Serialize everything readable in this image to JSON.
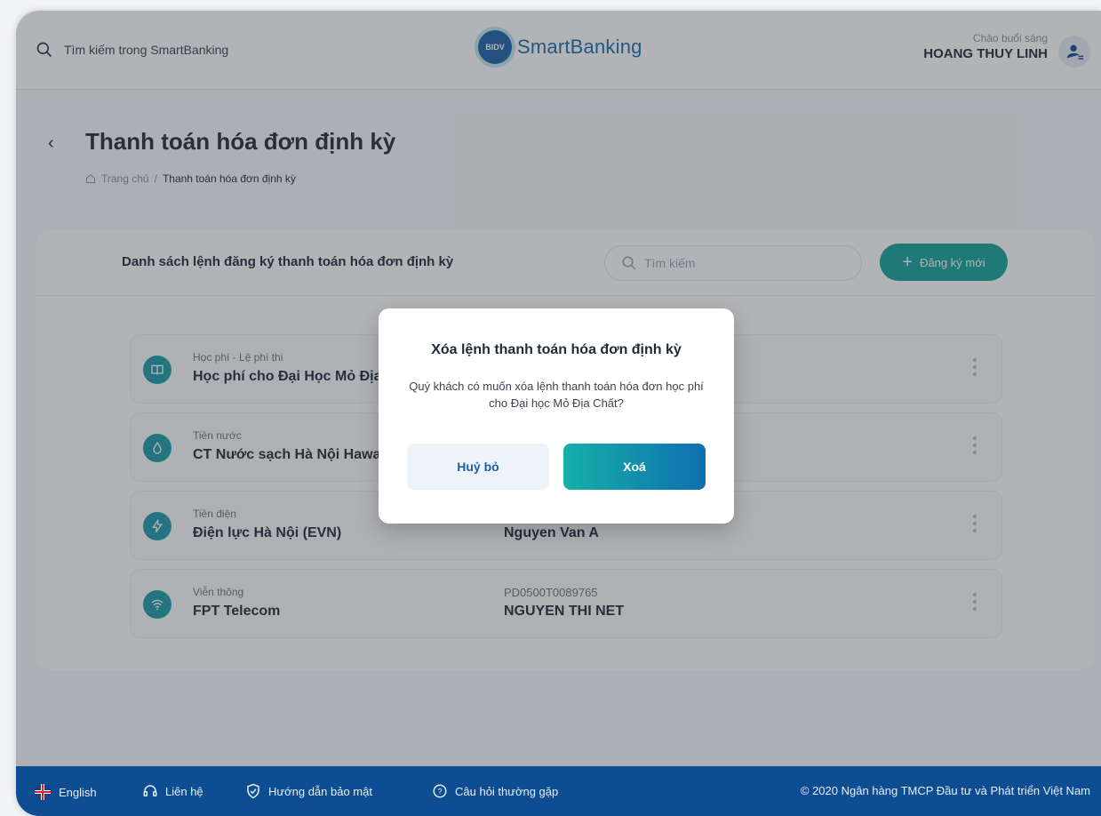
{
  "header": {
    "search_placeholder": "Tìm kiếm trong SmartBanking",
    "brand": "SmartBanking",
    "brand_badge": "BIDV",
    "greeting": "Chào buổi sáng",
    "user_name": "HOANG THUY LINH"
  },
  "page": {
    "title": "Thanh toán hóa đơn định kỳ",
    "breadcrumb_home": "Trang chủ",
    "breadcrumb_sep": "/",
    "breadcrumb_current": "Thanh toán hóa đơn định kỳ"
  },
  "list": {
    "title": "Danh sách lệnh đăng ký thanh toán hóa đơn định kỳ",
    "search_placeholder": "Tìm kiếm",
    "add_button": "Đăng ký mới",
    "rows": [
      {
        "category": "Học phí - Lệ phí thi",
        "name": "Học phí cho Đại Học Mỏ Địa Chất",
        "code": "",
        "holder": "",
        "icon": "book-icon"
      },
      {
        "category": "Tiền nước",
        "name": "CT Nước sạch Hà Nội Hawacom",
        "code": "",
        "holder": "",
        "icon": "water-drop-icon"
      },
      {
        "category": "Tiền điện",
        "name": "Điện lực Hà Nội (EVN)",
        "code": "",
        "holder": "Nguyen Van A",
        "icon": "lightning-icon"
      },
      {
        "category": "Viễn thông",
        "name": "FPT Telecom",
        "code": "PD0500T0089765",
        "holder": "NGUYEN THI NET",
        "icon": "wifi-icon"
      }
    ]
  },
  "modal": {
    "title": "Xóa lệnh thanh toán hóa đơn định kỳ",
    "body": "Quý khách có muốn xóa lệnh thanh toán hóa đơn học phí cho Đại học Mỏ Địa Chất?",
    "cancel": "Huỷ bỏ",
    "confirm": "Xoá"
  },
  "footer": {
    "language": "English",
    "contact": "Liên hệ",
    "security": "Hướng dẫn bảo mật",
    "faq": "Câu hỏi thường gặp",
    "copyright": "© 2020 Ngân hàng TMCP Đầu tư và Phát triển Việt Nam"
  },
  "colors": {
    "accent": "#14a39a",
    "brand": "#0f4d92",
    "footer": "#0f4d92"
  }
}
